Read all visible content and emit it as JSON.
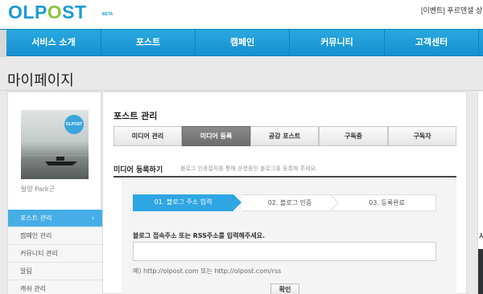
{
  "logo": {
    "text_a": "OLP",
    "text_o": "O",
    "text_b": "ST",
    "beta": "BETA"
  },
  "topbar": {
    "event_text": "[이벤트] 푸르덴셜 상"
  },
  "nav": {
    "items": [
      "서비스 소개",
      "포스트",
      "캠페인",
      "커뮤니티",
      "고객센터"
    ]
  },
  "page_title": "마이페이지",
  "sidebar": {
    "badge": "OLPOST",
    "profile_name": "탈양 Park군",
    "menu": [
      {
        "label": "포스트 관리",
        "arrow": "›"
      },
      {
        "label": "캠페인 관리"
      },
      {
        "label": "커뮤니티 관리"
      },
      {
        "label": "알림"
      },
      {
        "label": "캐쉬 관리"
      }
    ]
  },
  "main": {
    "section_title": "포스트 관리",
    "tabs": [
      "미디어 관리",
      "미디어 등록",
      "공감 포스트",
      "구독중",
      "구독자"
    ],
    "active_tab": "미디어 등록",
    "register_title": "미디어 등록하기",
    "register_desc": "블로그 인증절차를 통해 운영중인 블로그를 등록해 주세요.",
    "steps": [
      "01. 블로그 주소 입력",
      "02. 블로그 인증",
      "03. 등록완료"
    ],
    "form_label": "블로그 접속주소 또는 RSS주소를 입력해주세요.",
    "input_value": "",
    "input_placeholder": "",
    "example": "예) http://olpost.com 또는 http://olpost.com/rss",
    "confirm_label": "확인"
  },
  "right_panel": {
    "text": "사"
  },
  "colors": {
    "brand_blue": "#1a9ad6",
    "brand_green": "#8cc43f",
    "step_active": "#2ea6e3",
    "nav_blue": "#1b9ad8"
  }
}
